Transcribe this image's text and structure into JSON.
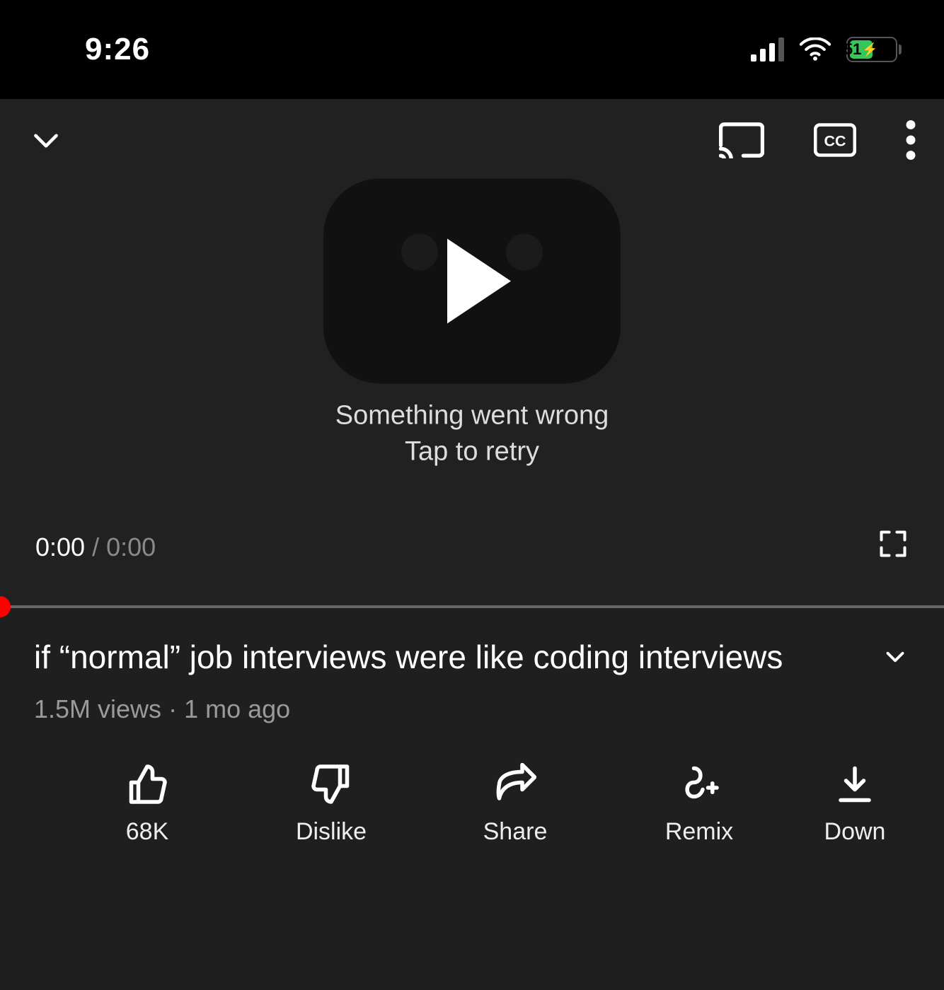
{
  "status": {
    "time": "9:26",
    "battery_pct": 51,
    "battery_label": "51",
    "cell_bars_active": 3,
    "cell_bars_total": 4
  },
  "player": {
    "error_line1": "Something went wrong",
    "error_line2": "Tap to retry",
    "current_time": "0:00",
    "time_separator": " / ",
    "duration": "0:00"
  },
  "video": {
    "title": "if “normal” job interviews were like coding interviews",
    "views": "1.5M views",
    "sep": " · ",
    "age": "1 mo ago"
  },
  "actions": {
    "like": {
      "label": "68K"
    },
    "dislike": {
      "label": "Dislike"
    },
    "share": {
      "label": "Share"
    },
    "remix": {
      "label": "Remix"
    },
    "download": {
      "label": "Down"
    }
  }
}
